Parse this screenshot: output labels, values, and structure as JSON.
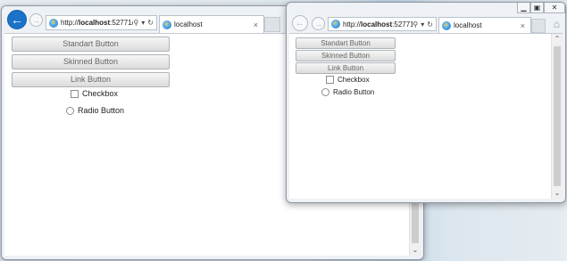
{
  "window_back": {
    "address": {
      "prefix": "http://",
      "host": "localhost",
      "rest": ":52771/l"
    },
    "tab": {
      "title": "localhost",
      "close": "×"
    },
    "buttons": {
      "standard": "Standart Button",
      "skinned": "Skinned Button",
      "link": "Link Button"
    },
    "checkbox_label": "Checkbox",
    "radio_label": "Radio Button"
  },
  "window_front": {
    "address": {
      "prefix": "http://",
      "host": "localhost",
      "rest": ":52771"
    },
    "tab": {
      "title": "localhost",
      "close": "×"
    },
    "buttons": {
      "standard": "Standart Button",
      "skinned": "Skinned Button",
      "link": "Link Button"
    },
    "checkbox_label": "Checkbox",
    "radio_label": "Radio Button"
  },
  "icons": {
    "back": "back-arrow-icon",
    "forward": "forward-arrow-icon",
    "search": "search-icon",
    "refresh": "refresh-icon",
    "home": "home-icon",
    "browser": "ie-logo-icon"
  },
  "colors": {
    "back_button": "#1a73c9",
    "button_text": "#666666"
  }
}
